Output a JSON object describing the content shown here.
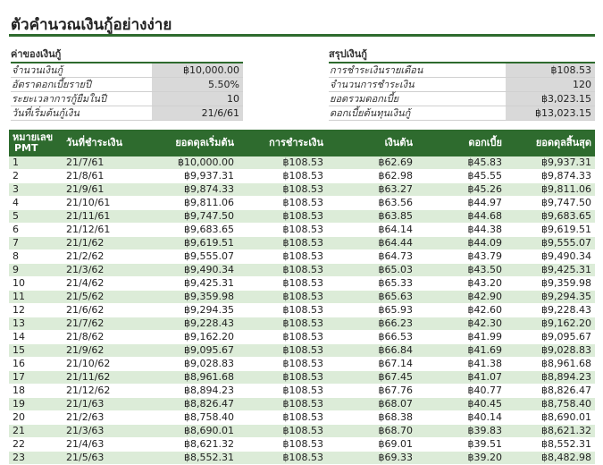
{
  "title": "ตัวคำนวณเงินกู้อย่างง่าย",
  "loan": {
    "heading": "ค่าของเงินกู้",
    "rows": [
      {
        "label": "จำนวนเงินกู้",
        "value": "฿10,000.00"
      },
      {
        "label": "อัตราดอกเบี้ยรายปี",
        "value": "5.50%"
      },
      {
        "label": "ระยะเวลาการกู้ยืมในปี",
        "value": "10"
      },
      {
        "label": "วันที่เริ่มต้นกู้เงิน",
        "value": "21/6/61"
      }
    ]
  },
  "summary": {
    "heading": "สรุปเงินกู้",
    "rows": [
      {
        "label": "การชำระเงินรายเดือน",
        "value": "฿108.53"
      },
      {
        "label": "จำนวนการชำระเงิน",
        "value": "120"
      },
      {
        "label": "ยอดรวมดอกเบี้ย",
        "value": "฿3,023.15"
      },
      {
        "label": "ดอกเบี้ยต้นทุนเงินกู้",
        "value": "฿13,023.15"
      }
    ]
  },
  "schedule": {
    "headers": {
      "num_line1": "หมายเลข",
      "num_line2": "PMT",
      "date": "วันที่ชำระเงิน",
      "begin": "ยอดดุลเริ่มต้น",
      "payment": "การชำระเงิน",
      "principal": "เงินต้น",
      "interest": "ดอกเบี้ย",
      "end": "ยอดดุลสิ้นสุด"
    },
    "rows": [
      [
        "1",
        "21/7/61",
        "฿10,000.00",
        "฿108.53",
        "฿62.69",
        "฿45.83",
        "฿9,937.31"
      ],
      [
        "2",
        "21/8/61",
        "฿9,937.31",
        "฿108.53",
        "฿62.98",
        "฿45.55",
        "฿9,874.33"
      ],
      [
        "3",
        "21/9/61",
        "฿9,874.33",
        "฿108.53",
        "฿63.27",
        "฿45.26",
        "฿9,811.06"
      ],
      [
        "4",
        "21/10/61",
        "฿9,811.06",
        "฿108.53",
        "฿63.56",
        "฿44.97",
        "฿9,747.50"
      ],
      [
        "5",
        "21/11/61",
        "฿9,747.50",
        "฿108.53",
        "฿63.85",
        "฿44.68",
        "฿9,683.65"
      ],
      [
        "6",
        "21/12/61",
        "฿9,683.65",
        "฿108.53",
        "฿64.14",
        "฿44.38",
        "฿9,619.51"
      ],
      [
        "7",
        "21/1/62",
        "฿9,619.51",
        "฿108.53",
        "฿64.44",
        "฿44.09",
        "฿9,555.07"
      ],
      [
        "8",
        "21/2/62",
        "฿9,555.07",
        "฿108.53",
        "฿64.73",
        "฿43.79",
        "฿9,490.34"
      ],
      [
        "9",
        "21/3/62",
        "฿9,490.34",
        "฿108.53",
        "฿65.03",
        "฿43.50",
        "฿9,425.31"
      ],
      [
        "10",
        "21/4/62",
        "฿9,425.31",
        "฿108.53",
        "฿65.33",
        "฿43.20",
        "฿9,359.98"
      ],
      [
        "11",
        "21/5/62",
        "฿9,359.98",
        "฿108.53",
        "฿65.63",
        "฿42.90",
        "฿9,294.35"
      ],
      [
        "12",
        "21/6/62",
        "฿9,294.35",
        "฿108.53",
        "฿65.93",
        "฿42.60",
        "฿9,228.43"
      ],
      [
        "13",
        "21/7/62",
        "฿9,228.43",
        "฿108.53",
        "฿66.23",
        "฿42.30",
        "฿9,162.20"
      ],
      [
        "14",
        "21/8/62",
        "฿9,162.20",
        "฿108.53",
        "฿66.53",
        "฿41.99",
        "฿9,095.67"
      ],
      [
        "15",
        "21/9/62",
        "฿9,095.67",
        "฿108.53",
        "฿66.84",
        "฿41.69",
        "฿9,028.83"
      ],
      [
        "16",
        "21/10/62",
        "฿9,028.83",
        "฿108.53",
        "฿67.14",
        "฿41.38",
        "฿8,961.68"
      ],
      [
        "17",
        "21/11/62",
        "฿8,961.68",
        "฿108.53",
        "฿67.45",
        "฿41.07",
        "฿8,894.23"
      ],
      [
        "18",
        "21/12/62",
        "฿8,894.23",
        "฿108.53",
        "฿67.76",
        "฿40.77",
        "฿8,826.47"
      ],
      [
        "19",
        "21/1/63",
        "฿8,826.47",
        "฿108.53",
        "฿68.07",
        "฿40.45",
        "฿8,758.40"
      ],
      [
        "20",
        "21/2/63",
        "฿8,758.40",
        "฿108.53",
        "฿68.38",
        "฿40.14",
        "฿8,690.01"
      ],
      [
        "21",
        "21/3/63",
        "฿8,690.01",
        "฿108.53",
        "฿68.70",
        "฿39.83",
        "฿8,621.32"
      ],
      [
        "22",
        "21/4/63",
        "฿8,621.32",
        "฿108.53",
        "฿69.01",
        "฿39.51",
        "฿8,552.31"
      ],
      [
        "23",
        "21/5/63",
        "฿8,552.31",
        "฿108.53",
        "฿69.33",
        "฿39.20",
        "฿8,482.98"
      ]
    ]
  },
  "colors": {
    "accent": "#2e6b2e",
    "band": "#dcecd8",
    "input_fill": "#d9d9d9"
  }
}
